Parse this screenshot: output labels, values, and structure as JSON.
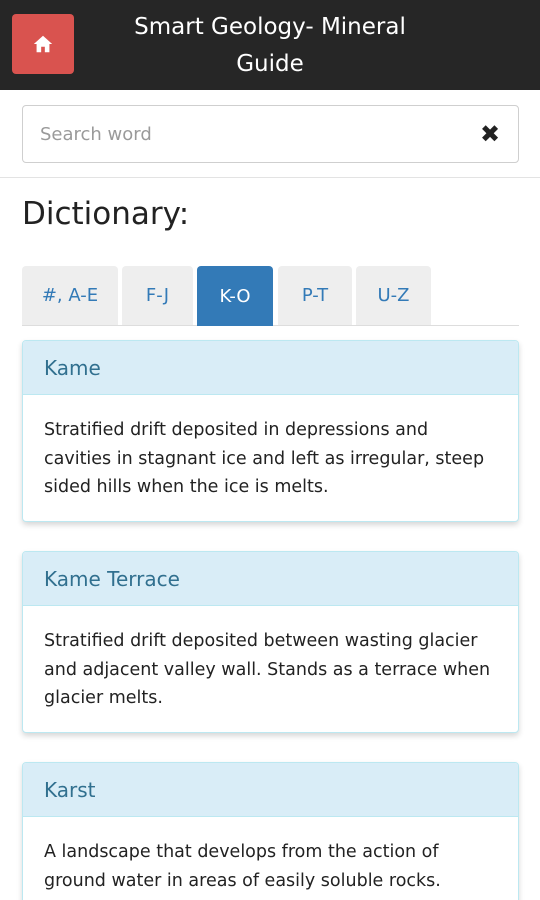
{
  "header": {
    "title": "Smart Geology- Mineral Guide",
    "home_icon": "home-icon"
  },
  "search": {
    "placeholder": "Search word",
    "value": "",
    "clear_icon": "close-icon"
  },
  "page": {
    "heading": "Dictionary:"
  },
  "tabs": [
    {
      "label": "#, A-E",
      "active": false
    },
    {
      "label": "F-J",
      "active": false
    },
    {
      "label": "K-O",
      "active": true
    },
    {
      "label": "P-T",
      "active": false
    },
    {
      "label": "U-Z",
      "active": false
    }
  ],
  "entries": [
    {
      "term": "Kame",
      "definition": "Stratified drift deposited in depressions and cavities in stagnant ice and left as irregular, steep sided hills when the ice is melts."
    },
    {
      "term": "Kame Terrace",
      "definition": "Stratified drift deposited between wasting glacier and adjacent valley wall. Stands as a terrace when glacier melts."
    },
    {
      "term": "Karst",
      "definition": "A landscape that develops from the action of ground water in areas of easily soluble rocks."
    }
  ],
  "colors": {
    "header_bg": "#262626",
    "home_button": "#d9534f",
    "tab_active": "#337ab7",
    "card_header_bg": "#d9edf7",
    "card_title": "#31708f"
  }
}
